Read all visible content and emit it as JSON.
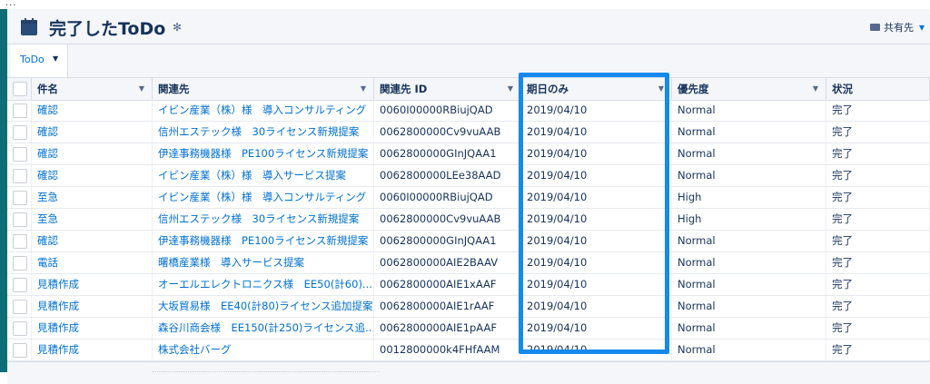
{
  "top": {
    "dots": "..."
  },
  "header": {
    "title": "完了したToDo",
    "gear_icon": "gear-icon",
    "share_label": "共有先",
    "share_chevron": "▾"
  },
  "tabs": [
    {
      "label": "ToDo",
      "chevron": "▼"
    }
  ],
  "table": {
    "columns": [
      "件名",
      "関連先",
      "関連先 ID",
      "期日のみ",
      "優先度",
      "状況"
    ],
    "sort_arrow": "▼",
    "rows": [
      {
        "subject": "確認",
        "related": "イビン産業（株）様　導入コンサルティング",
        "related_id": "0060I00000RBiujQAD",
        "due": "2019/04/10",
        "priority": "Normal",
        "status": "完了"
      },
      {
        "subject": "確認",
        "related": "信州エステック様　30ライセンス新規提案",
        "related_id": "0062800000Cv9vuAAB",
        "due": "2019/04/10",
        "priority": "Normal",
        "status": "完了"
      },
      {
        "subject": "確認",
        "related": "伊達事務機器様　PE100ライセンス新規提案",
        "related_id": "0062800000GInJQAA1",
        "due": "2019/04/10",
        "priority": "Normal",
        "status": "完了"
      },
      {
        "subject": "確認",
        "related": "イビン産業（株）様　導入サービス提案",
        "related_id": "0062800000LEe38AAD",
        "due": "2019/04/10",
        "priority": "Normal",
        "status": "完了"
      },
      {
        "subject": "至急",
        "related": "イビン産業（株）様　導入コンサルティング",
        "related_id": "0060I00000RBiujQAD",
        "due": "2019/04/10",
        "priority": "High",
        "status": "完了"
      },
      {
        "subject": "至急",
        "related": "信州エステック様　30ライセンス新規提案",
        "related_id": "0062800000Cv9vuAAB",
        "due": "2019/04/10",
        "priority": "High",
        "status": "完了"
      },
      {
        "subject": "確認",
        "related": "伊達事務機器様　PE100ライセンス新規提案",
        "related_id": "0062800000GInJQAA1",
        "due": "2019/04/10",
        "priority": "Normal",
        "status": "完了"
      },
      {
        "subject": "電話",
        "related": "曙橋産業様　導入サービス提案",
        "related_id": "0062800000AIE2BAAV",
        "due": "2019/04/10",
        "priority": "Normal",
        "status": "完了"
      },
      {
        "subject": "見積作成",
        "related": "オーエルエレクトロニクス様　EE50(計60)...",
        "related_id": "0062800000AIE1xAAF",
        "due": "2019/04/10",
        "priority": "Normal",
        "status": "完了"
      },
      {
        "subject": "見積作成",
        "related": "大坂貿易様　EE40(計80)ライセンス追加提案",
        "related_id": "0062800000AIE1rAAF",
        "due": "2019/04/10",
        "priority": "Normal",
        "status": "完了"
      },
      {
        "subject": "見積作成",
        "related": "森谷川商会様　EE150(計250)ライセンス追...",
        "related_id": "0062800000AIE1pAAF",
        "due": "2019/04/10",
        "priority": "Normal",
        "status": "完了"
      },
      {
        "subject": "見積作成",
        "related": "株式会社バーグ",
        "related_id": "0012800000k4FHfAAM",
        "due": "2019/04/10",
        "priority": "Normal",
        "status": "完了"
      }
    ]
  },
  "colors": {
    "accent": "#0070d2",
    "highlight": "#1589ee",
    "rail": "#0e6e78",
    "text": "#16325c"
  }
}
